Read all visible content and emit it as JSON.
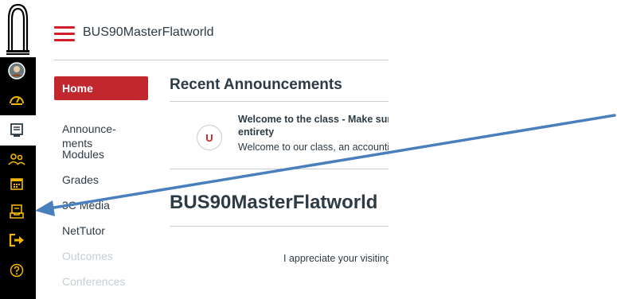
{
  "header": {
    "course_title": "BUS90MasterFlatworld"
  },
  "global_nav": {
    "icons": [
      "university-logo-icon",
      "account-avatar-icon",
      "dashboard-icon",
      "courses-icon",
      "groups-icon",
      "calendar-icon",
      "inbox-icon",
      "logout-icon",
      "help-icon"
    ]
  },
  "course_nav": {
    "items": [
      {
        "label": "Home"
      },
      {
        "label": "Announce-\nments"
      },
      {
        "label": "Modules"
      },
      {
        "label": "Grades"
      },
      {
        "label": "3C Media"
      },
      {
        "label": "NetTutor"
      },
      {
        "label": "Outcomes"
      },
      {
        "label": "Conferences"
      }
    ]
  },
  "main": {
    "recent_title": "Recent Announcements",
    "announcement": {
      "avatar_letter": "U",
      "title": "Welcome to the class - Make sure to read this entirety",
      "preview": "Welcome to our class, an accounting course"
    },
    "big_title": "BUS90MasterFlatworld",
    "body_text": "I appreciate your visiting"
  },
  "colors": {
    "brand_red": "#c1272d",
    "rail_icon_yellow": "#f2b705",
    "arrow_blue": "#4a7fbd"
  }
}
